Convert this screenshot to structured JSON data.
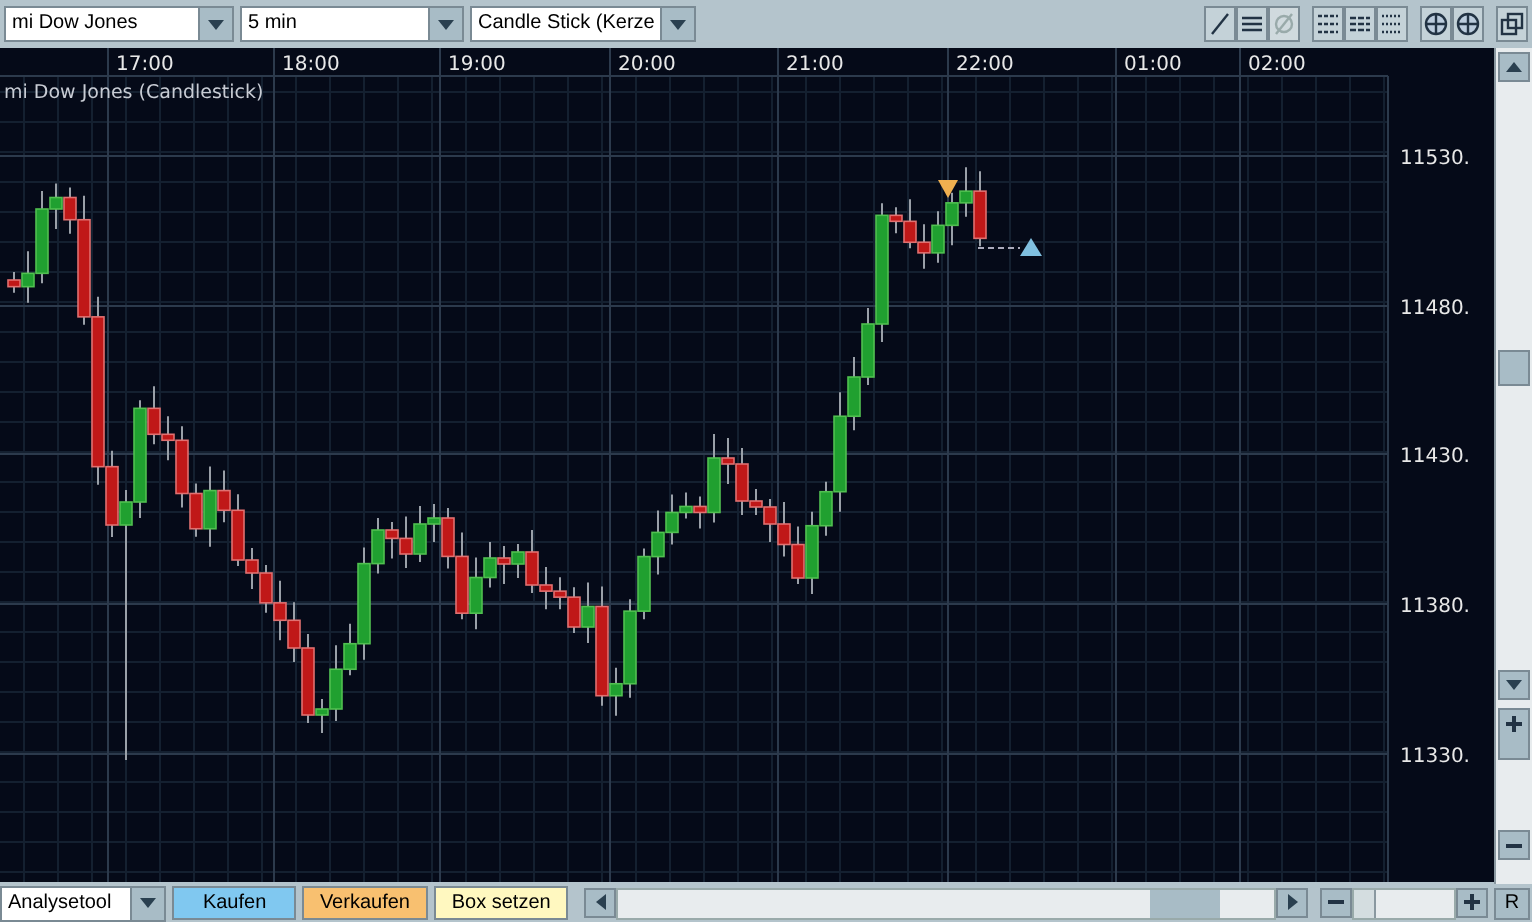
{
  "toolbar": {
    "instrument": "mi Dow Jones",
    "interval": "5 min",
    "chart_type": "Candle Stick (Kerze",
    "tool_icons": [
      {
        "kind": "pen",
        "disabled": false
      },
      {
        "kind": "lines",
        "disabled": false
      },
      {
        "kind": "slash",
        "disabled": true
      },
      {
        "kind": "grid",
        "disabled": false
      },
      {
        "kind": "dashgrid",
        "disabled": false
      },
      {
        "kind": "dotgrid",
        "disabled": false
      },
      {
        "kind": "globe",
        "disabled": false
      },
      {
        "kind": "globe",
        "disabled": false
      },
      {
        "kind": "windows",
        "disabled": false
      }
    ]
  },
  "chart": {
    "title": "mi Dow Jones (Candlestick)",
    "time_labels": [
      "17:00",
      "18:00",
      "19:00",
      "20:00",
      "21:00",
      "22:00",
      "01:00",
      "02:00"
    ],
    "price_labels": [
      "11530.",
      "11480.",
      "11430.",
      "11380.",
      "11330."
    ]
  },
  "bottom_bar": {
    "tool": "Analysetool",
    "buttons": [
      {
        "label": "Kaufen",
        "kind": "buy"
      },
      {
        "label": "Verkaufen",
        "kind": "sell"
      },
      {
        "label": "Box setzen",
        "kind": "box"
      }
    ],
    "zoom": {
      "level": 0.2
    },
    "reset": "R"
  }
}
